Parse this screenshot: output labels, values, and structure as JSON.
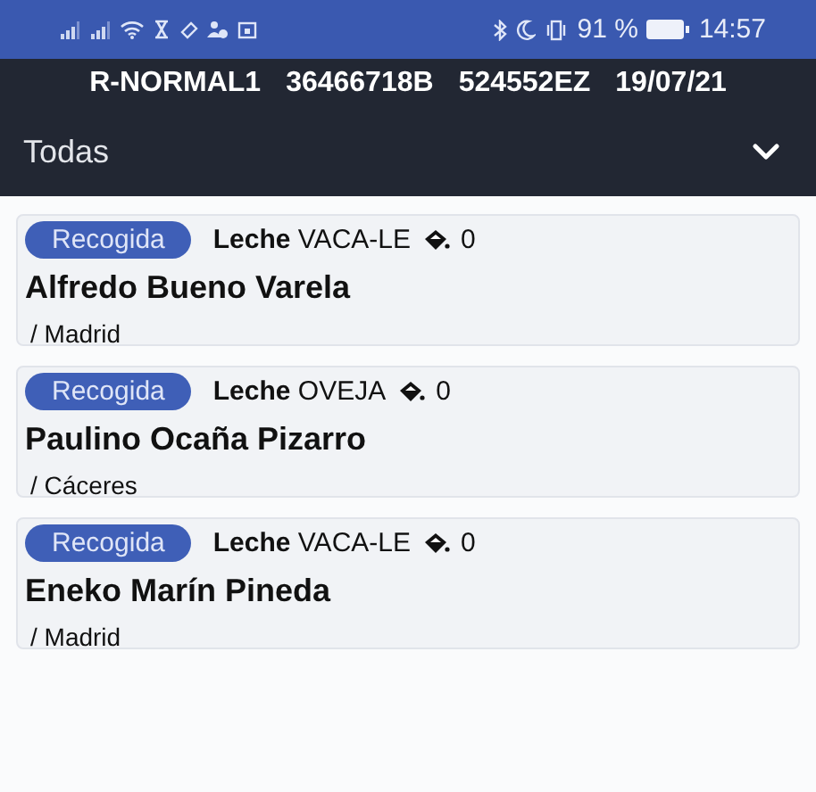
{
  "status_bar": {
    "battery_percent": "91 %",
    "time": "14:57"
  },
  "header": {
    "title_items": [
      "R-NORMAL1",
      "36466718B",
      "524552EZ",
      "19/07/21"
    ]
  },
  "filter": {
    "value": "Todas",
    "expanded": false
  },
  "cards": [
    {
      "badge": "Recogida",
      "product": "**Leche** VACA-LE",
      "count": "0",
      "name": "Alfredo Bueno Varela",
      "location": "/ Madrid"
    },
    {
      "badge": "Recogida",
      "product": "**Leche** OVEJA",
      "count": "0",
      "name": "Paulino Ocaña Pizarro",
      "location": "/ Cáceres"
    },
    {
      "badge": "Recogida",
      "product": "**Leche** VACA-LE",
      "count": "0",
      "name": "Eneko Marín Pineda",
      "location": "/ Madrid"
    }
  ]
}
